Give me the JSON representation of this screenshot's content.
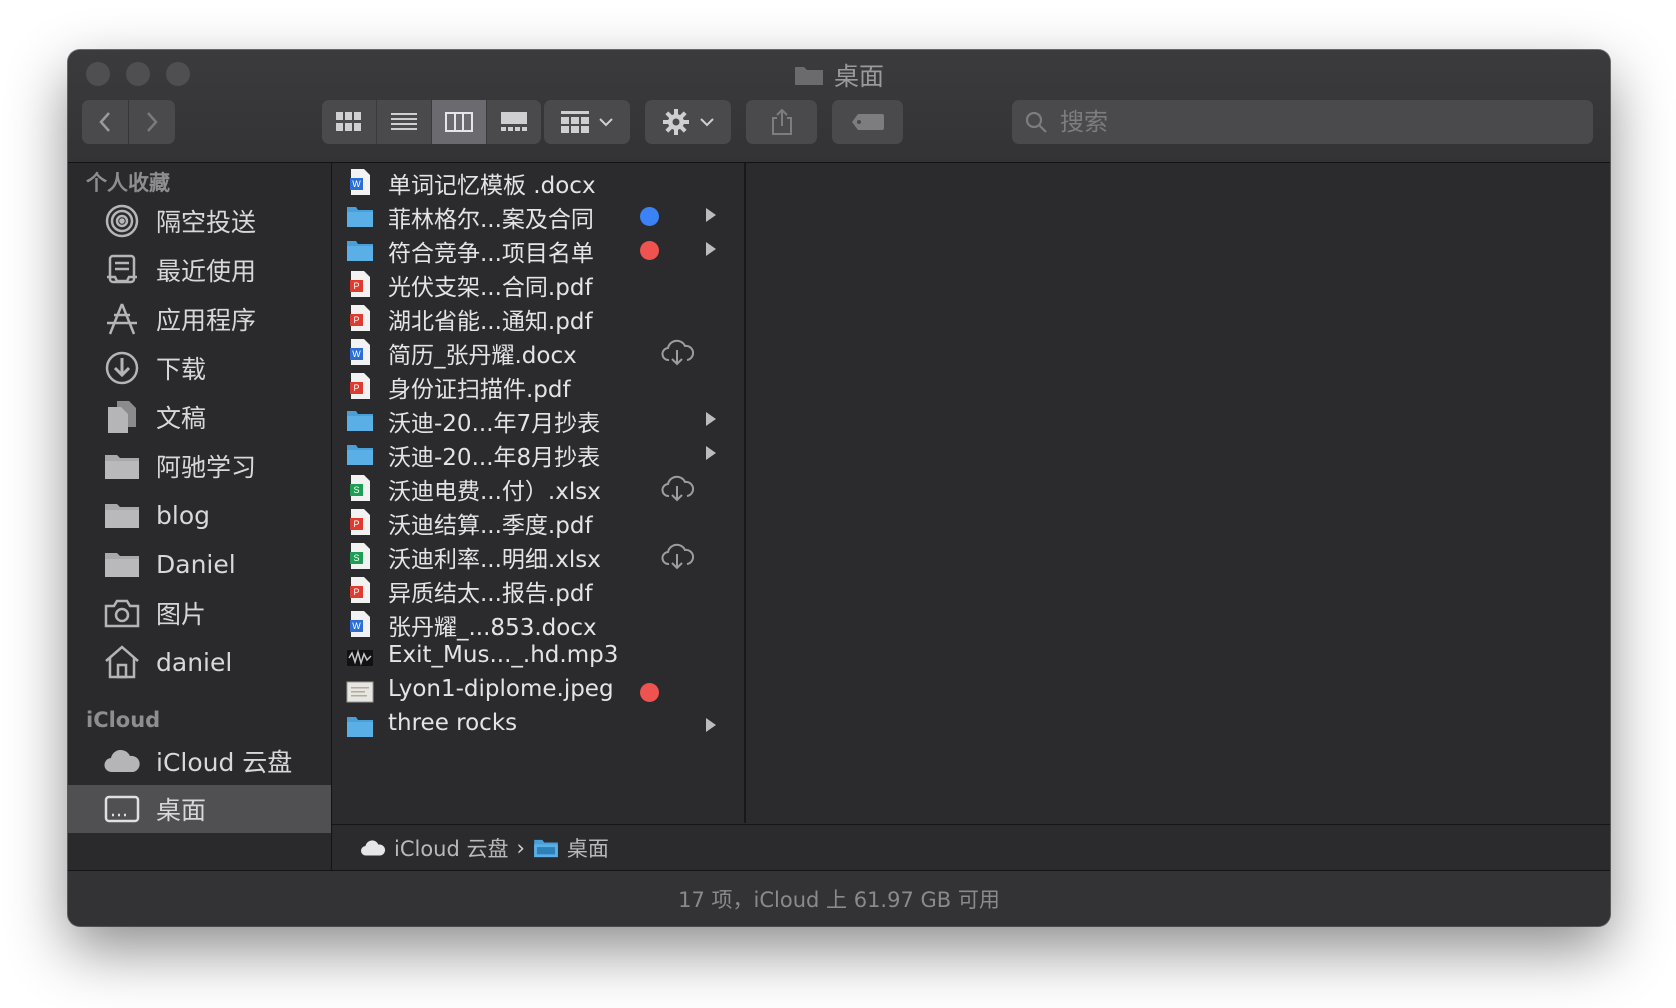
{
  "window": {
    "title": "桌面"
  },
  "toolbar": {
    "back_icon": "chevron-left-icon",
    "forward_icon": "chevron-right-icon",
    "view_modes": [
      "icon-view",
      "list-view",
      "column-view",
      "gallery-view"
    ],
    "active_view": "column-view",
    "search_placeholder": "搜索"
  },
  "sidebar": {
    "favorites_header": "个人收藏",
    "favorites": [
      {
        "label": "隔空投送",
        "icon": "airdrop-icon"
      },
      {
        "label": "最近使用",
        "icon": "recents-icon"
      },
      {
        "label": "应用程序",
        "icon": "applications-icon"
      },
      {
        "label": "下载",
        "icon": "downloads-icon"
      },
      {
        "label": "文稿",
        "icon": "documents-icon"
      },
      {
        "label": "阿驰学习",
        "icon": "folder-icon"
      },
      {
        "label": "blog",
        "icon": "folder-icon"
      },
      {
        "label": "Daniel",
        "icon": "folder-icon"
      },
      {
        "label": "图片",
        "icon": "camera-icon"
      },
      {
        "label": "daniel",
        "icon": "home-icon"
      }
    ],
    "icloud_header": "iCloud",
    "icloud": [
      {
        "label": "iCloud 云盘",
        "icon": "cloud-icon"
      },
      {
        "label": "桌面",
        "icon": "desktop-icon",
        "selected": true
      }
    ]
  },
  "files": [
    {
      "name": "单词记忆模板 .docx",
      "kind": "docx"
    },
    {
      "name": "菲林格尔...案及合同",
      "kind": "folder",
      "tag": "#3b82f6",
      "has_children": true
    },
    {
      "name": "符合竞争...项目名单",
      "kind": "folder",
      "tag": "#ef5350",
      "has_children": true
    },
    {
      "name": "光伏支架...合同.pdf",
      "kind": "pdf"
    },
    {
      "name": "湖北省能...通知.pdf",
      "kind": "pdf"
    },
    {
      "name": "简历_张丹耀.docx",
      "kind": "docx",
      "cloud": true
    },
    {
      "name": "身份证扫描件.pdf",
      "kind": "pdf"
    },
    {
      "name": "沃迪-20...年7月抄表",
      "kind": "folder",
      "has_children": true
    },
    {
      "name": "沃迪-20...年8月抄表",
      "kind": "folder",
      "has_children": true
    },
    {
      "name": "沃迪电费...付）.xlsx",
      "kind": "xlsx",
      "cloud": true
    },
    {
      "name": "沃迪结算...季度.pdf",
      "kind": "pdf"
    },
    {
      "name": "沃迪利率...明细.xlsx",
      "kind": "xlsx",
      "cloud": true
    },
    {
      "name": "异质结太...报告.pdf",
      "kind": "pdf"
    },
    {
      "name": "张丹耀_...853.docx",
      "kind": "docx"
    },
    {
      "name": "Exit_Mus..._.hd.mp3",
      "kind": "mp3"
    },
    {
      "name": "Lyon1-diplome.jpeg",
      "kind": "jpeg",
      "tag": "#ef5350"
    },
    {
      "name": "three rocks",
      "kind": "folder",
      "has_children": true
    }
  ],
  "pathbar": {
    "root": "iCloud 云盘",
    "separator": "›",
    "current": "桌面"
  },
  "status": "17 项，iCloud 上 61.97 GB 可用",
  "colors": {
    "folder": "#5ab0e6",
    "docx": "#2b6fd6",
    "pdf": "#e03b2f",
    "xlsx": "#1f9d55",
    "tag_blue": "#3b82f6",
    "tag_red": "#ef5350"
  }
}
